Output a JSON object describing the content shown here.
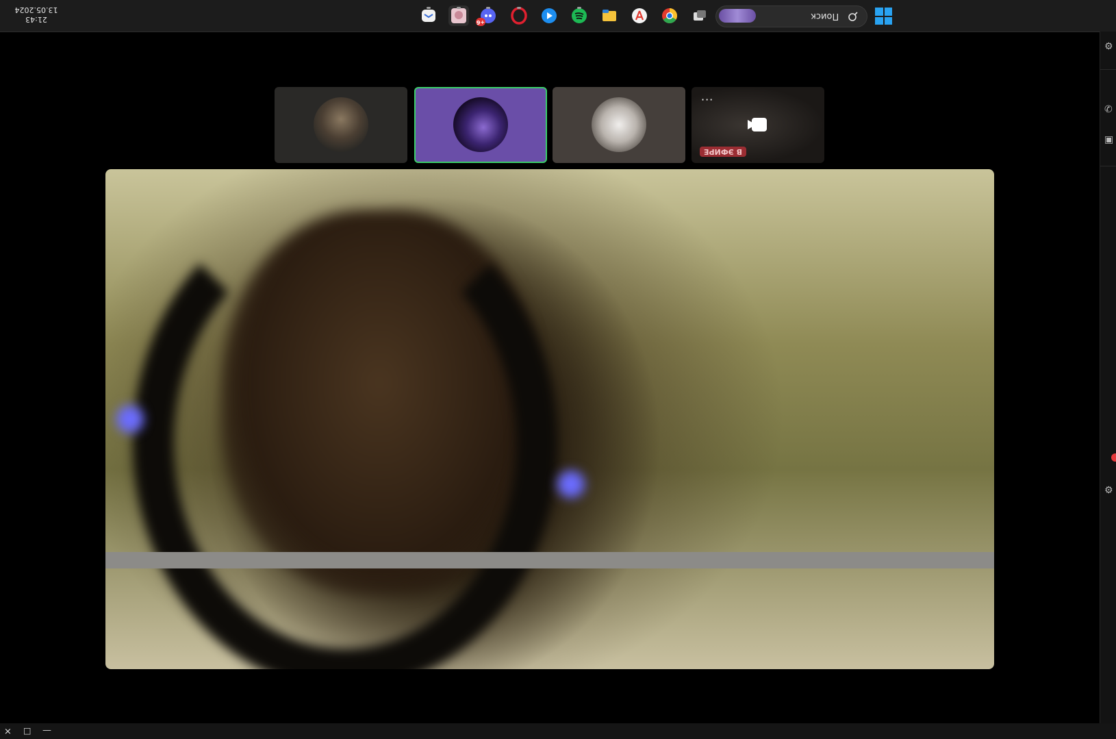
{
  "taskbar": {
    "clock": {
      "time": "21:43",
      "date": "13.05.2024"
    },
    "search": {
      "label": "Поиск"
    },
    "apps": [
      {
        "name": "app-icon-1"
      },
      {
        "name": "app-avatar"
      },
      {
        "name": "discord",
        "badge": "+6"
      },
      {
        "name": "opera"
      },
      {
        "name": "media-player"
      },
      {
        "name": "spotify"
      },
      {
        "name": "file-explorer"
      },
      {
        "name": "adobe-acrobat"
      },
      {
        "name": "chrome"
      },
      {
        "name": "task-view"
      }
    ]
  },
  "call": {
    "tiles": [
      {
        "name": "participant-1",
        "speaking": false
      },
      {
        "name": "participant-2",
        "speaking": true,
        "color": "#6a4ea8"
      },
      {
        "name": "participant-3",
        "speaking": false
      },
      {
        "name": "participant-stream",
        "live_label": "В ЭФИРЕ"
      }
    ]
  },
  "colors": {
    "speaking_ring": "#3ccf6a",
    "live_badge": "#9b2d33",
    "accent": "#29a3f2"
  },
  "window": {
    "close": "✕",
    "maximize": "☐",
    "minimize": "—"
  }
}
